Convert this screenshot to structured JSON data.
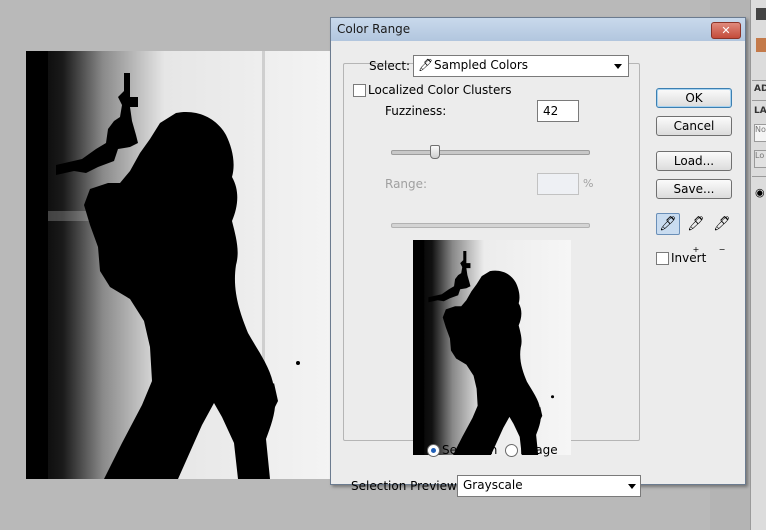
{
  "dialog": {
    "title": "Color Range",
    "close_label": "✕",
    "select_label": "Select:",
    "select_value": "Sampled Colors",
    "localized_label": "Localized Color Clusters",
    "localized_checked": false,
    "fuzziness_label": "Fuzziness:",
    "fuzziness_value": "42",
    "range_label": "Range:",
    "range_value": "",
    "range_unit": "%",
    "view_options": [
      {
        "label": "Selection",
        "selected": true
      },
      {
        "label": "Image",
        "selected": false
      }
    ],
    "selection_preview_label": "Selection Preview:",
    "selection_preview_value": "Grayscale",
    "buttons": {
      "ok": "OK",
      "cancel": "Cancel",
      "load": "Load...",
      "save": "Save..."
    },
    "invert_label": "Invert",
    "invert_checked": false,
    "tools": [
      "eyedropper-icon",
      "eyedropper-plus-icon",
      "eyedropper-minus-icon"
    ]
  },
  "right_panel": {
    "tab_adjust": "AD",
    "tab_layers": "LA",
    "field_text": "No",
    "field2_text": "Lo"
  },
  "colors": {
    "title_bar": "#b9cce4",
    "close_button": "#c44b3a",
    "ok_border": "#3c7fb1",
    "radio_selected": "#1f5fb8"
  }
}
